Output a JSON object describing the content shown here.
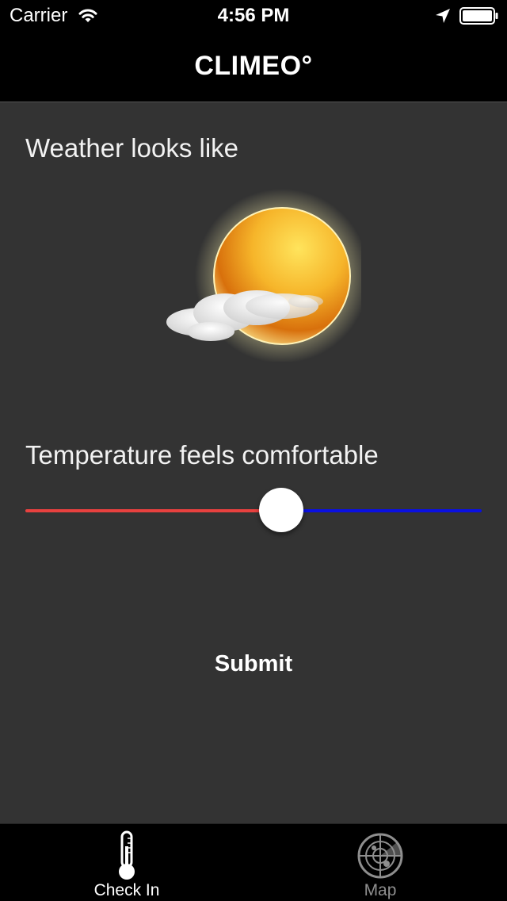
{
  "status_bar": {
    "carrier": "Carrier",
    "time": "4:56 PM",
    "icons": [
      "wifi-icon",
      "location-arrow-icon",
      "battery-icon"
    ]
  },
  "nav": {
    "title": "CLIMEO°"
  },
  "weather": {
    "label": "Weather looks like",
    "icon": "sun-with-cloud-icon"
  },
  "temperature": {
    "label": "Temperature feels comfortable",
    "slider_value": 0.56,
    "min_track_color": "#e8413f",
    "max_track_color": "#0a10e0"
  },
  "submit": {
    "label": "Submit"
  },
  "tabs": [
    {
      "label": "Check In",
      "icon": "thermometer-icon",
      "active": true
    },
    {
      "label": "Map",
      "icon": "radar-icon",
      "active": false
    }
  ],
  "colors": {
    "background": "#333333",
    "bars": "#000000",
    "text": "#ffffff",
    "inactive_tab": "#8e8e8e"
  }
}
